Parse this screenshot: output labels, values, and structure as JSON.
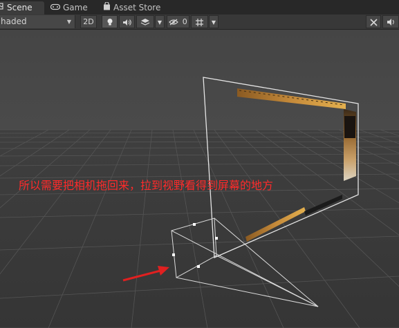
{
  "tabs": [
    {
      "label": "Scene",
      "icon": "scene-icon",
      "active": true
    },
    {
      "label": "Game",
      "icon": "gamepad-icon",
      "active": false
    },
    {
      "label": "Asset Store",
      "icon": "store-bag-icon",
      "active": false
    }
  ],
  "toolbar": {
    "draw_mode": "haded",
    "btn_2d": "2D",
    "hidden_count": "0",
    "icons": [
      "lightbulb-icon",
      "speaker-icon",
      "layers-icon",
      "eye-hidden-icon",
      "grid-icon",
      "tools-icon",
      "sound-toggle-icon"
    ]
  },
  "viewport": {
    "annotation": "所以需要把相机拖回来，拉到视野看得到屏幕的地方",
    "annotation_color": "#ff2a2a",
    "background_color": "#474747",
    "arrow_color": "#e02020"
  }
}
